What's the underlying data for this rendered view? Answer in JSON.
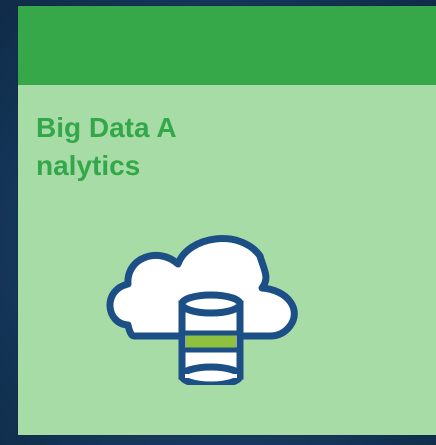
{
  "card": {
    "title": "Big Data Analytics"
  },
  "icons": {
    "main": "cloud-database-icon"
  },
  "colors": {
    "background": "#163a5e",
    "card_body": "#a8dca6",
    "card_header": "#37a84a",
    "title_text": "#33a84a",
    "icon_outline": "#1b4f86",
    "icon_accent": "#8dc13f"
  }
}
